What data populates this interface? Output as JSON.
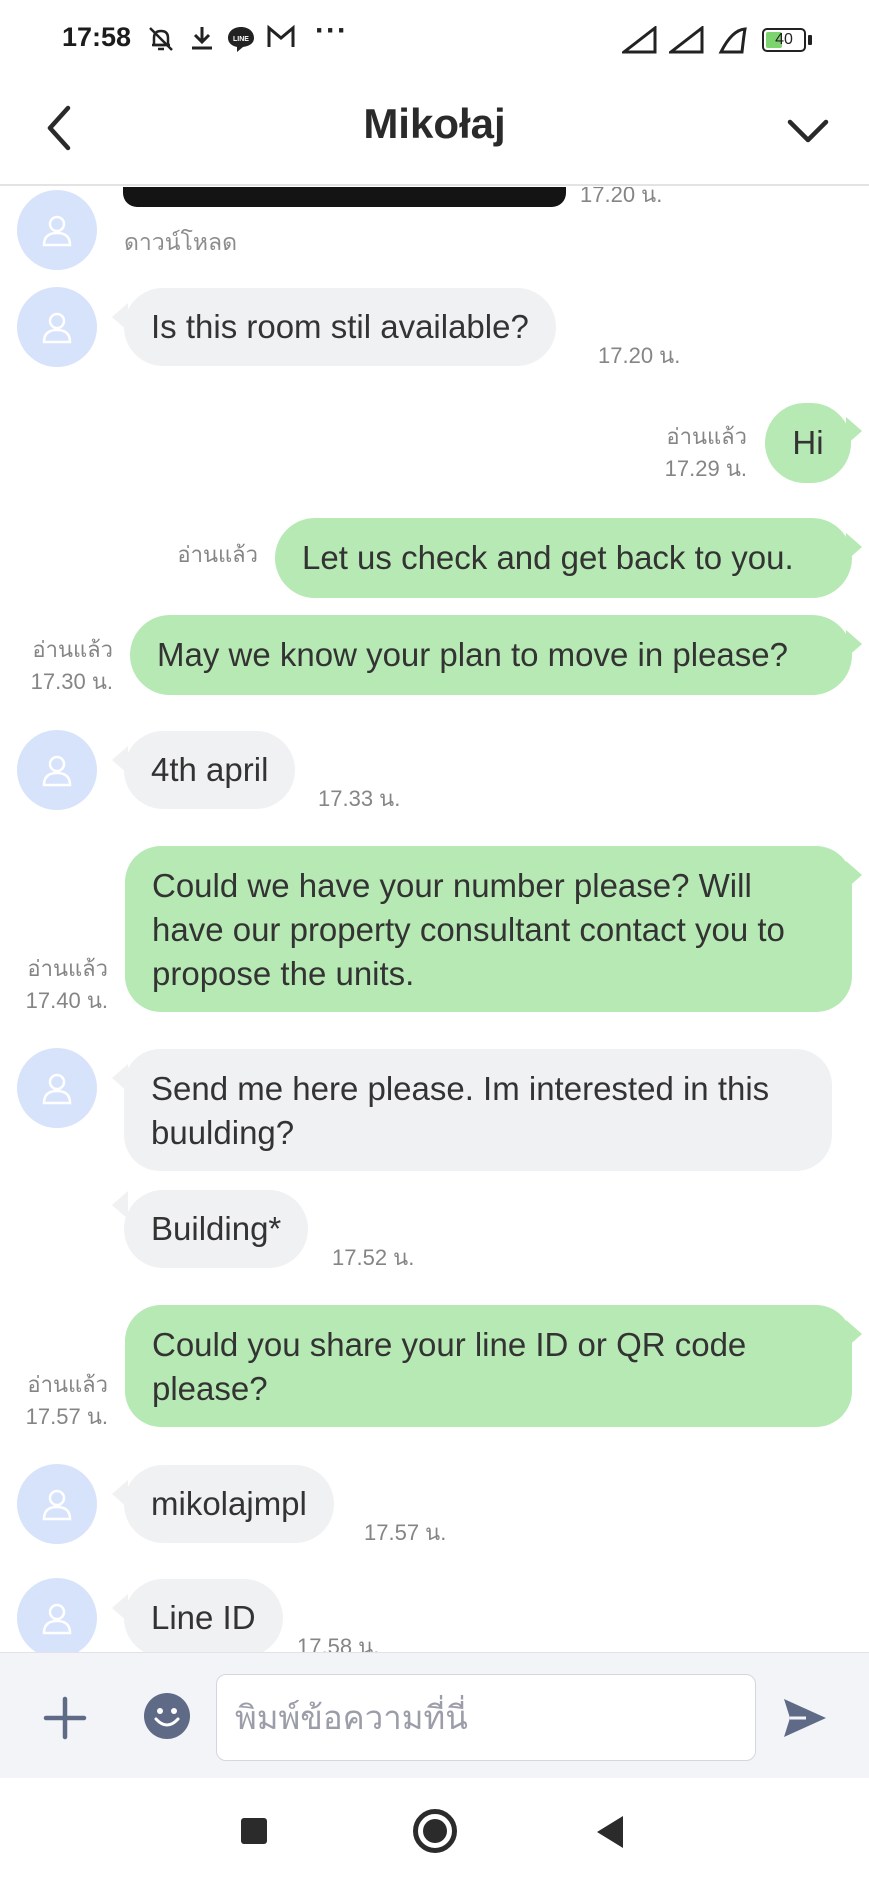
{
  "status_bar": {
    "time": "17:58",
    "icons": [
      "bell-off-icon",
      "download-icon",
      "line-icon",
      "gmail-icon"
    ],
    "more": "···",
    "signal_icons": [
      "signal-1-icon",
      "signal-2-icon",
      "wifi-icon"
    ],
    "battery": "40"
  },
  "header": {
    "title": "Mikołaj",
    "back_icon": "chevron-left-icon",
    "expand_icon": "chevron-down-icon"
  },
  "chat": {
    "top_partial": {
      "download_label": "ดาวน์โหลด",
      "time": "17.20 น."
    },
    "messages": [
      {
        "dir": "in",
        "text": "Is this room stil available?",
        "time": "17.20 น."
      },
      {
        "dir": "out",
        "text": "Hi",
        "read": "อ่านแล้ว",
        "time": "17.29 น."
      },
      {
        "dir": "out",
        "text": "Let us check and get back to you.",
        "read": "อ่านแล้ว"
      },
      {
        "dir": "out",
        "text": "May we know your plan to move in please?",
        "read": "อ่านแล้ว",
        "time": "17.30 น."
      },
      {
        "dir": "in",
        "text": "4th april",
        "time": "17.33 น."
      },
      {
        "dir": "out",
        "text": "Could we have your number please? Will have our property consultant contact you to propose the units.",
        "read": "อ่านแล้ว",
        "time": "17.40 น."
      },
      {
        "dir": "in",
        "text": "Send me here please. Im interested in this buulding?"
      },
      {
        "dir": "in",
        "text": "Building*",
        "time": "17.52 น."
      },
      {
        "dir": "out",
        "text": "Could you share your line ID or QR code please?",
        "read": "อ่านแล้ว",
        "time": "17.57 น."
      },
      {
        "dir": "in",
        "text": "mikolajmpl",
        "time": "17.57 น."
      },
      {
        "dir": "in",
        "text": "Line ID",
        "time": "17.58 น."
      }
    ]
  },
  "input": {
    "placeholder": "พิมพ์ข้อความที่นี่",
    "plus_icon": "plus-icon",
    "emoji_icon": "emoji-icon",
    "send_icon": "send-icon"
  },
  "nav": {
    "recent_icon": "square-icon",
    "home_icon": "home-circle-icon",
    "back_icon": "triangle-back-icon"
  },
  "colors": {
    "outgoing_bubble": "#b6e9b3",
    "incoming_bubble": "#f0f1f3",
    "avatar_bg": "#d6e3fb"
  }
}
